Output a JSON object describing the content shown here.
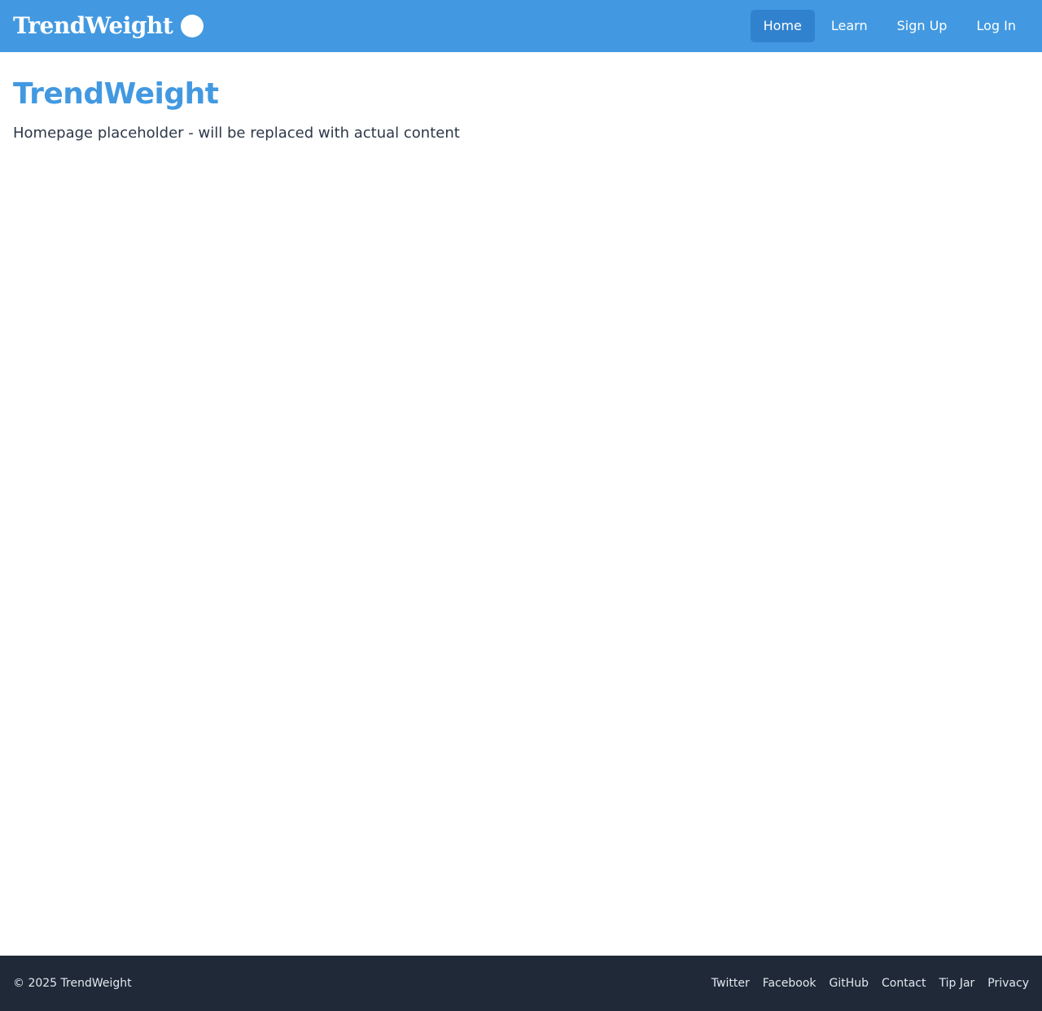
{
  "header": {
    "logo_text": "TrendWeight",
    "nav": [
      {
        "label": "Home",
        "active": true
      },
      {
        "label": "Learn",
        "active": false
      },
      {
        "label": "Sign Up",
        "active": false
      },
      {
        "label": "Log In",
        "active": false
      }
    ]
  },
  "main": {
    "title": "TrendWeight",
    "subtitle": "Homepage placeholder - will be replaced with actual content"
  },
  "footer": {
    "copyright": "© 2025 TrendWeight",
    "links": [
      {
        "label": "Twitter"
      },
      {
        "label": "Facebook"
      },
      {
        "label": "GitHub"
      },
      {
        "label": "Contact"
      },
      {
        "label": "Tip Jar"
      },
      {
        "label": "Privacy"
      }
    ]
  },
  "colors": {
    "header_bg": "#4299e1",
    "nav_active_bg": "#3182ce",
    "title": "#4299e1",
    "text": "#2d3748",
    "footer_bg": "#1f2937",
    "footer_text": "#e2e8f0"
  }
}
